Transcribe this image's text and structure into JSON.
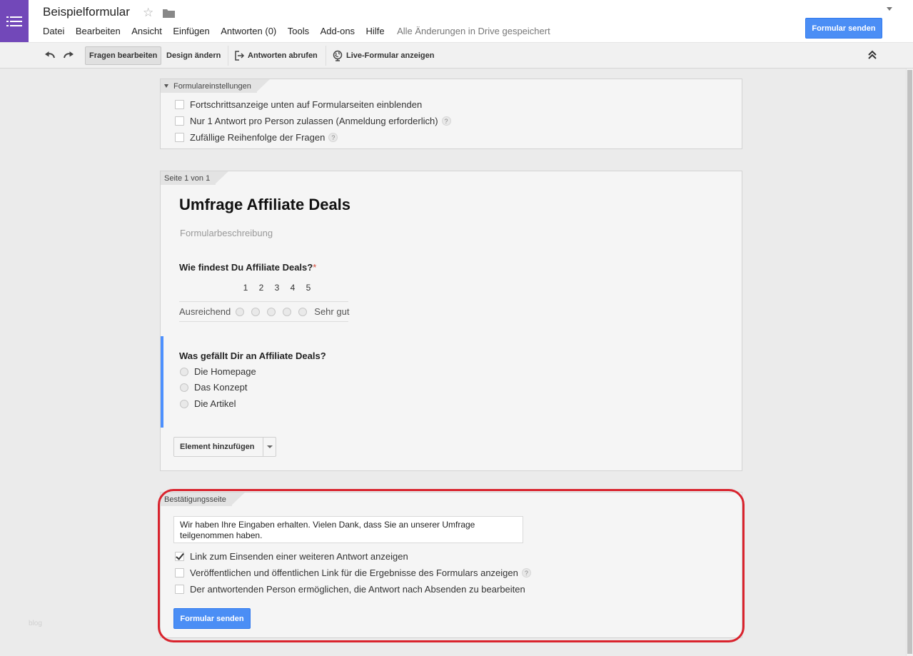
{
  "app": {
    "doc_title": "Beispielformular",
    "menu": [
      "Datei",
      "Bearbeiten",
      "Ansicht",
      "Einfügen",
      "Antworten (0)",
      "Tools",
      "Add-ons",
      "Hilfe"
    ],
    "save_status": "Alle Änderungen in Drive gespeichert",
    "send_button": "Formular senden",
    "brand_color": "#7248b9"
  },
  "toolbar": {
    "edit_questions": "Fragen bearbeiten",
    "change_design": "Design ändern",
    "get_responses": "Antworten abrufen",
    "view_live": "Live-Formular anzeigen"
  },
  "settings": {
    "tab": "Formulareinstellungen",
    "options": [
      {
        "label": "Fortschrittsanzeige unten auf Formularseiten einblenden",
        "checked": false,
        "help": false
      },
      {
        "label": "Nur 1 Antwort pro Person zulassen (Anmeldung erforderlich)",
        "checked": false,
        "help": true
      },
      {
        "label": "Zufällige Reihenfolge der Fragen",
        "checked": false,
        "help": true
      }
    ]
  },
  "page": {
    "tab": "Seite 1 von 1",
    "form_title": "Umfrage Affiliate Deals",
    "form_description": "Formularbeschreibung",
    "q1": {
      "title": "Wie findest Du Affiliate Deals?",
      "required_mark": "*",
      "scale": [
        "1",
        "2",
        "3",
        "4",
        "5"
      ],
      "low_label": "Ausreichend",
      "high_label": "Sehr gut"
    },
    "q2": {
      "title": "Was gefällt Dir an Affiliate Deals?",
      "options": [
        "Die Homepage",
        "Das Konzept",
        "Die Artikel"
      ]
    },
    "add_item": "Element hinzufügen"
  },
  "confirmation": {
    "tab": "Bestätigungsseite",
    "message": "Wir haben Ihre Eingaben erhalten. Vielen Dank, dass Sie an unserer Umfrage teilgenommen haben.",
    "options": [
      {
        "label": "Link zum Einsenden einer weiteren Antwort anzeigen",
        "checked": true,
        "help": false
      },
      {
        "label": "Veröffentlichen und öffentlichen Link für die Ergebnisse des Formulars anzeigen",
        "checked": false,
        "help": true
      },
      {
        "label": "Der antwortenden Person ermöglichen, die Antwort nach Absenden zu bearbeiten",
        "checked": false,
        "help": false
      }
    ],
    "send_button": "Formular senden"
  },
  "watermark": "blog"
}
